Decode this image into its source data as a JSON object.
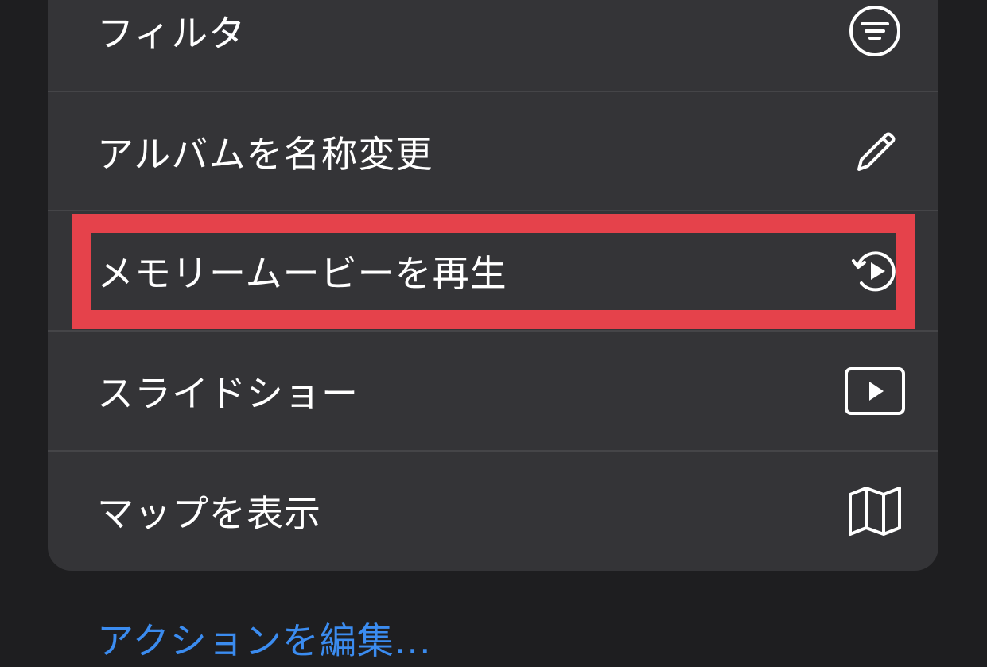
{
  "menu": {
    "items": [
      {
        "label": "フィルタ",
        "icon": "filter-icon"
      },
      {
        "label": "アルバムを名称変更",
        "icon": "pencil-icon"
      },
      {
        "label": "メモリームービーを再生",
        "icon": "memory-movie-play-icon"
      },
      {
        "label": "スライドショー",
        "icon": "slideshow-play-icon"
      },
      {
        "label": "マップを表示",
        "icon": "map-icon"
      }
    ]
  },
  "footer": {
    "edit_actions_label": "アクションを編集..."
  },
  "colors": {
    "menu_background": "#343437",
    "screen_background": "#1e1e20",
    "text": "#ffffff",
    "link": "#3b8cf0",
    "highlight": "#e5424b"
  }
}
